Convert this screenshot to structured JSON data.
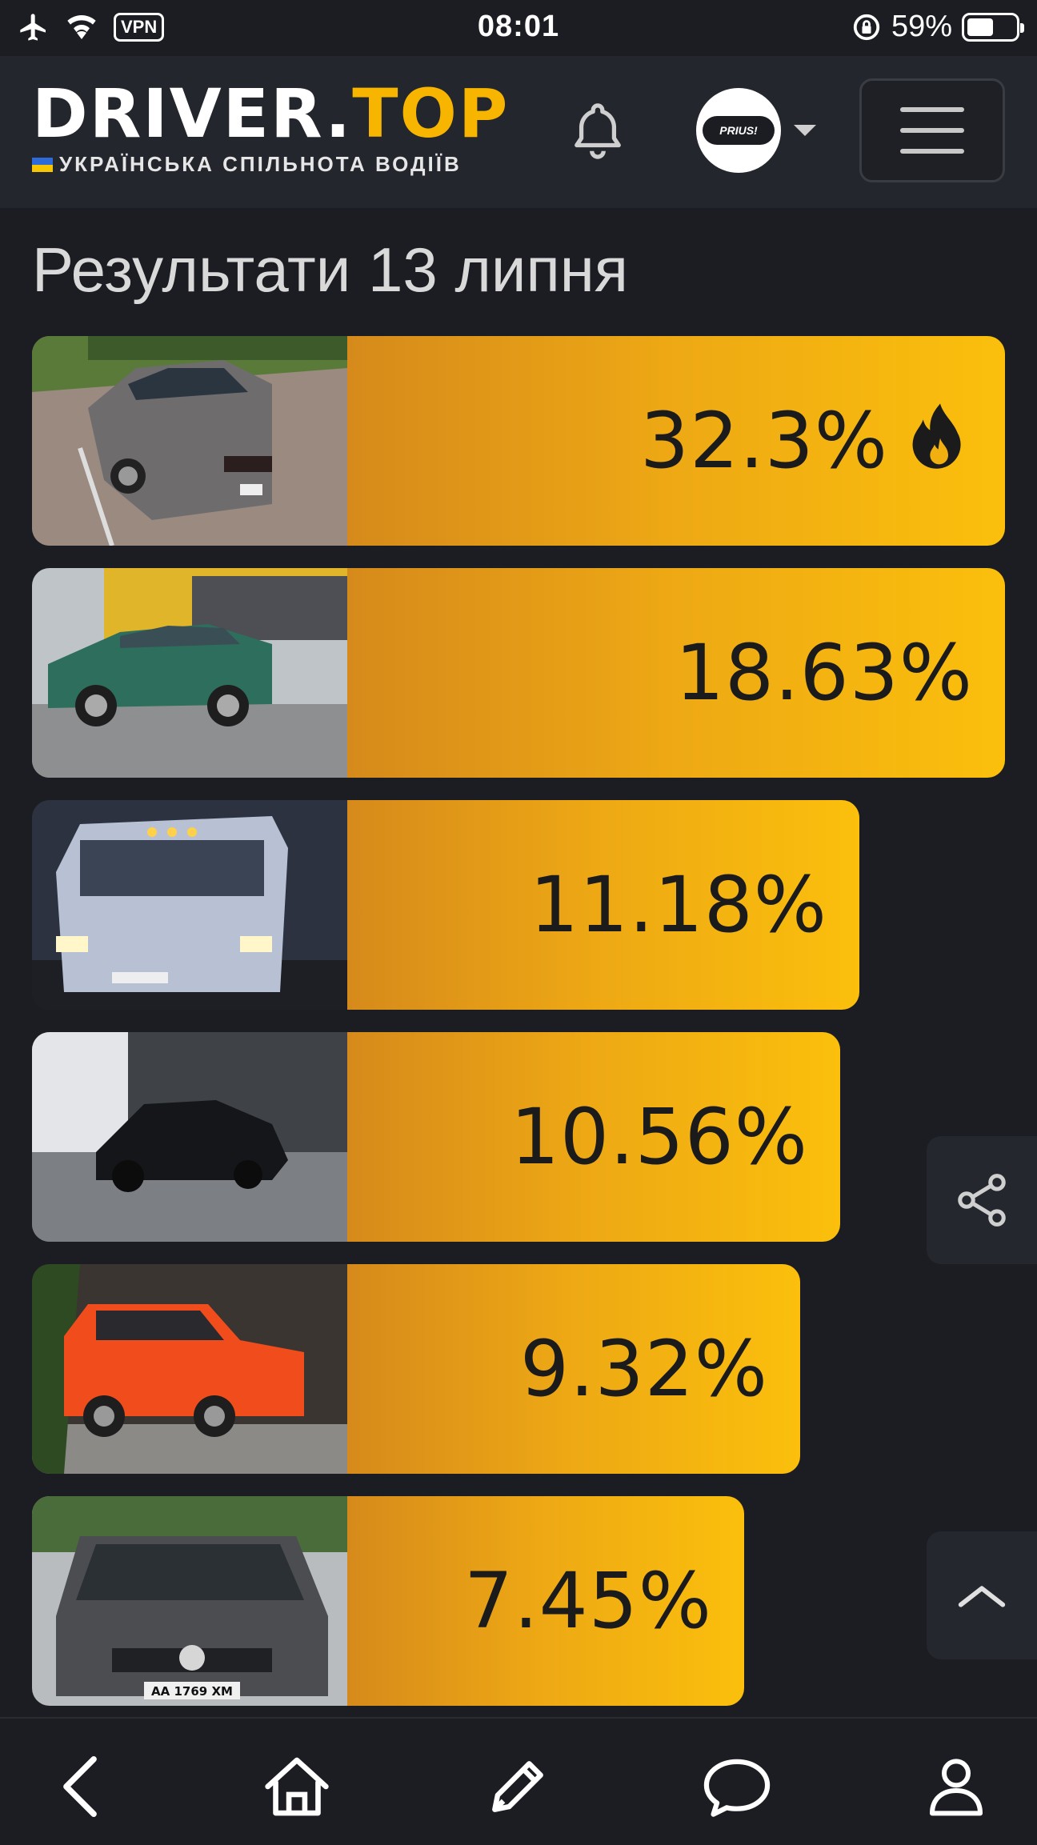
{
  "status_bar": {
    "time": "08:01",
    "vpn_label": "VPN",
    "battery_percent": "59%",
    "icons": [
      "airplane-icon",
      "wifi-icon",
      "rotation-lock-icon",
      "battery-icon"
    ]
  },
  "header": {
    "logo_main_part1": "DRIVER.",
    "logo_main_part2": "TOP",
    "logo_subtitle": "УКРАЇНСЬКА СПІЛЬНОТА ВОДІЇВ",
    "avatar_text": "PRIUS!",
    "brand_accent": "#f7b500"
  },
  "page": {
    "title": "Результати 13 липня"
  },
  "results": [
    {
      "percent": "32.3%",
      "share": 0.323,
      "leader": true,
      "car": "grey Dodge Challenger"
    },
    {
      "percent": "18.63%",
      "share": 0.1863,
      "leader": false,
      "car": "green VW Golf"
    },
    {
      "percent": "11.18%",
      "share": 0.1118,
      "leader": false,
      "car": "silver van"
    },
    {
      "percent": "10.56%",
      "share": 0.1056,
      "leader": false,
      "car": "black BMW sedan"
    },
    {
      "percent": "9.32%",
      "share": 0.0932,
      "leader": false,
      "car": "orange Jeep Renegade"
    },
    {
      "percent": "7.45%",
      "share": 0.0745,
      "leader": false,
      "car": "grey VW Passat",
      "plate": "AA 1769 XM"
    }
  ],
  "bottom_nav": [
    "back-icon",
    "home-icon",
    "edit-icon",
    "chat-icon",
    "profile-icon"
  ]
}
